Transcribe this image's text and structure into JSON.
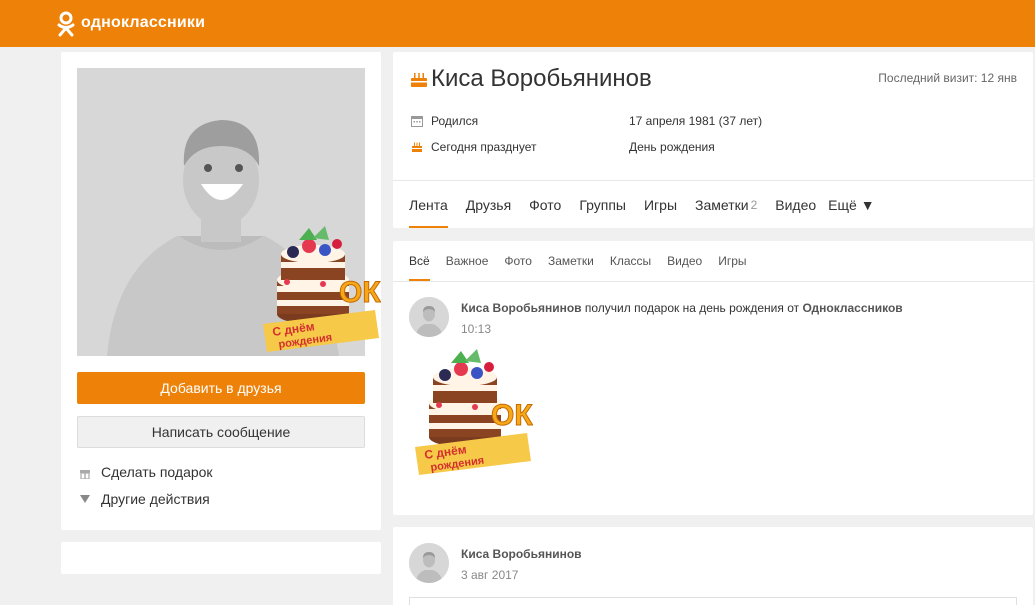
{
  "header": {
    "logo_text": "одноклассники",
    "brand_color": "#ee8208"
  },
  "sidebar": {
    "add_friend_label": "Добавить в друзья",
    "message_label": "Написать сообщение",
    "actions": [
      {
        "label": "Сделать подарок",
        "icon": "gift-icon"
      },
      {
        "label": "Другие действия",
        "icon": "triangle-down-icon"
      }
    ]
  },
  "gift_sticker": {
    "line1": "С днём",
    "line2": "рождения",
    "badge": "ОК"
  },
  "profile": {
    "name": "Киса Воробьянинов",
    "last_visit": "Последний визит: 12 янв",
    "info": [
      {
        "label": "Родился",
        "value": "17 апреля 1981 (37 лет)",
        "icon": "calendar-icon"
      },
      {
        "label": "Сегодня празднует",
        "value": "День рождения",
        "icon": "cake-icon"
      }
    ],
    "tabs": [
      {
        "label": "Лента",
        "active": true
      },
      {
        "label": "Друзья"
      },
      {
        "label": "Фото"
      },
      {
        "label": "Группы"
      },
      {
        "label": "Игры"
      },
      {
        "label": "Заметки",
        "count": "2"
      },
      {
        "label": "Видео"
      },
      {
        "label": "Ещё ▼"
      }
    ]
  },
  "feed": {
    "subtabs": [
      "Всё",
      "Важное",
      "Фото",
      "Заметки",
      "Классы",
      "Видео",
      "Игры"
    ],
    "posts": [
      {
        "author": "Киса Воробьянинов",
        "action": " получил подарок на день рождения от ",
        "target": "Одноклассников",
        "time": "10:13"
      },
      {
        "author": "Киса Воробьянинов",
        "time": "3 авг 2017"
      }
    ]
  }
}
